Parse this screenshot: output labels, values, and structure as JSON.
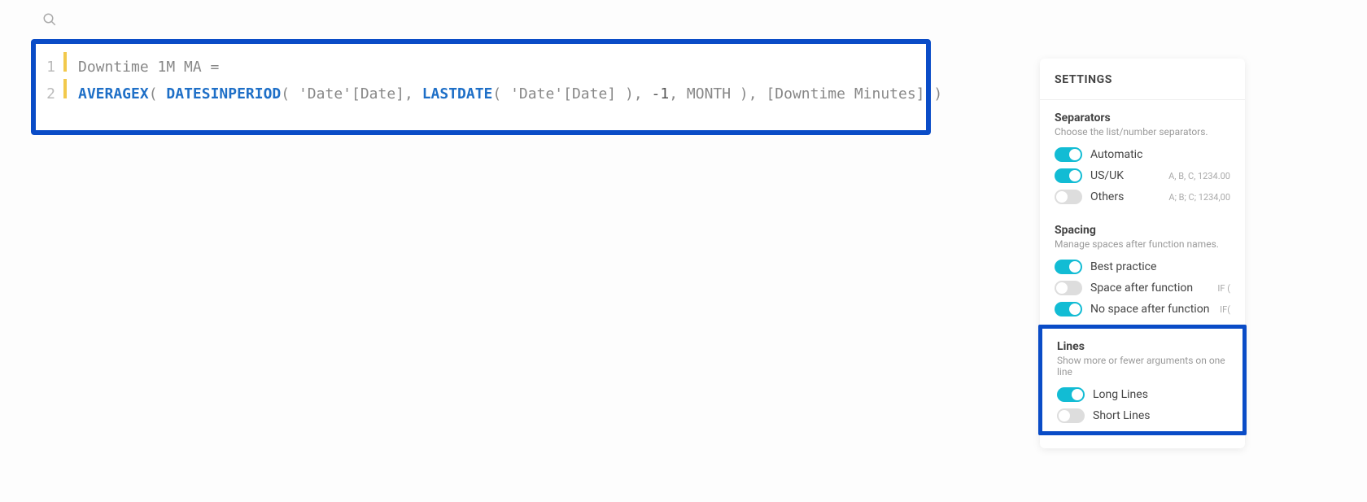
{
  "search": {
    "placeholder": ""
  },
  "code": {
    "lines": [
      {
        "n": "1",
        "tokens": [
          {
            "cls": "tok-p",
            "t": "Downtime 1M MA ="
          }
        ]
      },
      {
        "n": "2",
        "tokens": [
          {
            "cls": "tok-k",
            "t": "AVERAGEX"
          },
          {
            "cls": "tok-pn",
            "t": "( "
          },
          {
            "cls": "tok-k",
            "t": "DATESINPERIOD"
          },
          {
            "cls": "tok-pn",
            "t": "( "
          },
          {
            "cls": "tok-s",
            "t": "'Date'[Date]"
          },
          {
            "cls": "tok-pn",
            "t": ", "
          },
          {
            "cls": "tok-k",
            "t": "LASTDATE"
          },
          {
            "cls": "tok-pn",
            "t": "( "
          },
          {
            "cls": "tok-s",
            "t": "'Date'[Date]"
          },
          {
            "cls": "tok-pn",
            "t": " )"
          },
          {
            "cls": "tok-pn",
            "t": ", "
          },
          {
            "cls": "tok-n",
            "t": "-1"
          },
          {
            "cls": "tok-pn",
            "t": ", "
          },
          {
            "cls": "tok-p",
            "t": "MONTH"
          },
          {
            "cls": "tok-pn",
            "t": " )"
          },
          {
            "cls": "tok-pn",
            "t": ", "
          },
          {
            "cls": "tok-p",
            "t": "[Downtime Minutes]"
          },
          {
            "cls": "tok-pn",
            "t": " )"
          }
        ]
      }
    ]
  },
  "settings": {
    "title": "SETTINGS",
    "sections": [
      {
        "key": "separators",
        "title": "Separators",
        "desc": "Choose the list/number separators.",
        "highlighted": false,
        "options": [
          {
            "label": "Automatic",
            "hint": "",
            "on": true
          },
          {
            "label": "US/UK",
            "hint": "A, B, C, 1234.00",
            "on": true
          },
          {
            "label": "Others",
            "hint": "A; B; C; 1234,00",
            "on": false
          }
        ]
      },
      {
        "key": "spacing",
        "title": "Spacing",
        "desc": "Manage spaces after function names.",
        "highlighted": false,
        "options": [
          {
            "label": "Best practice",
            "hint": "",
            "on": true
          },
          {
            "label": "Space after function",
            "hint": "IF (",
            "on": false
          },
          {
            "label": "No space after function",
            "hint": "IF(",
            "on": true
          }
        ]
      },
      {
        "key": "lines",
        "title": "Lines",
        "desc": "Show more or fewer arguments on one line",
        "highlighted": true,
        "options": [
          {
            "label": "Long Lines",
            "hint": "",
            "on": true
          },
          {
            "label": "Short Lines",
            "hint": "",
            "on": false
          }
        ]
      }
    ]
  }
}
